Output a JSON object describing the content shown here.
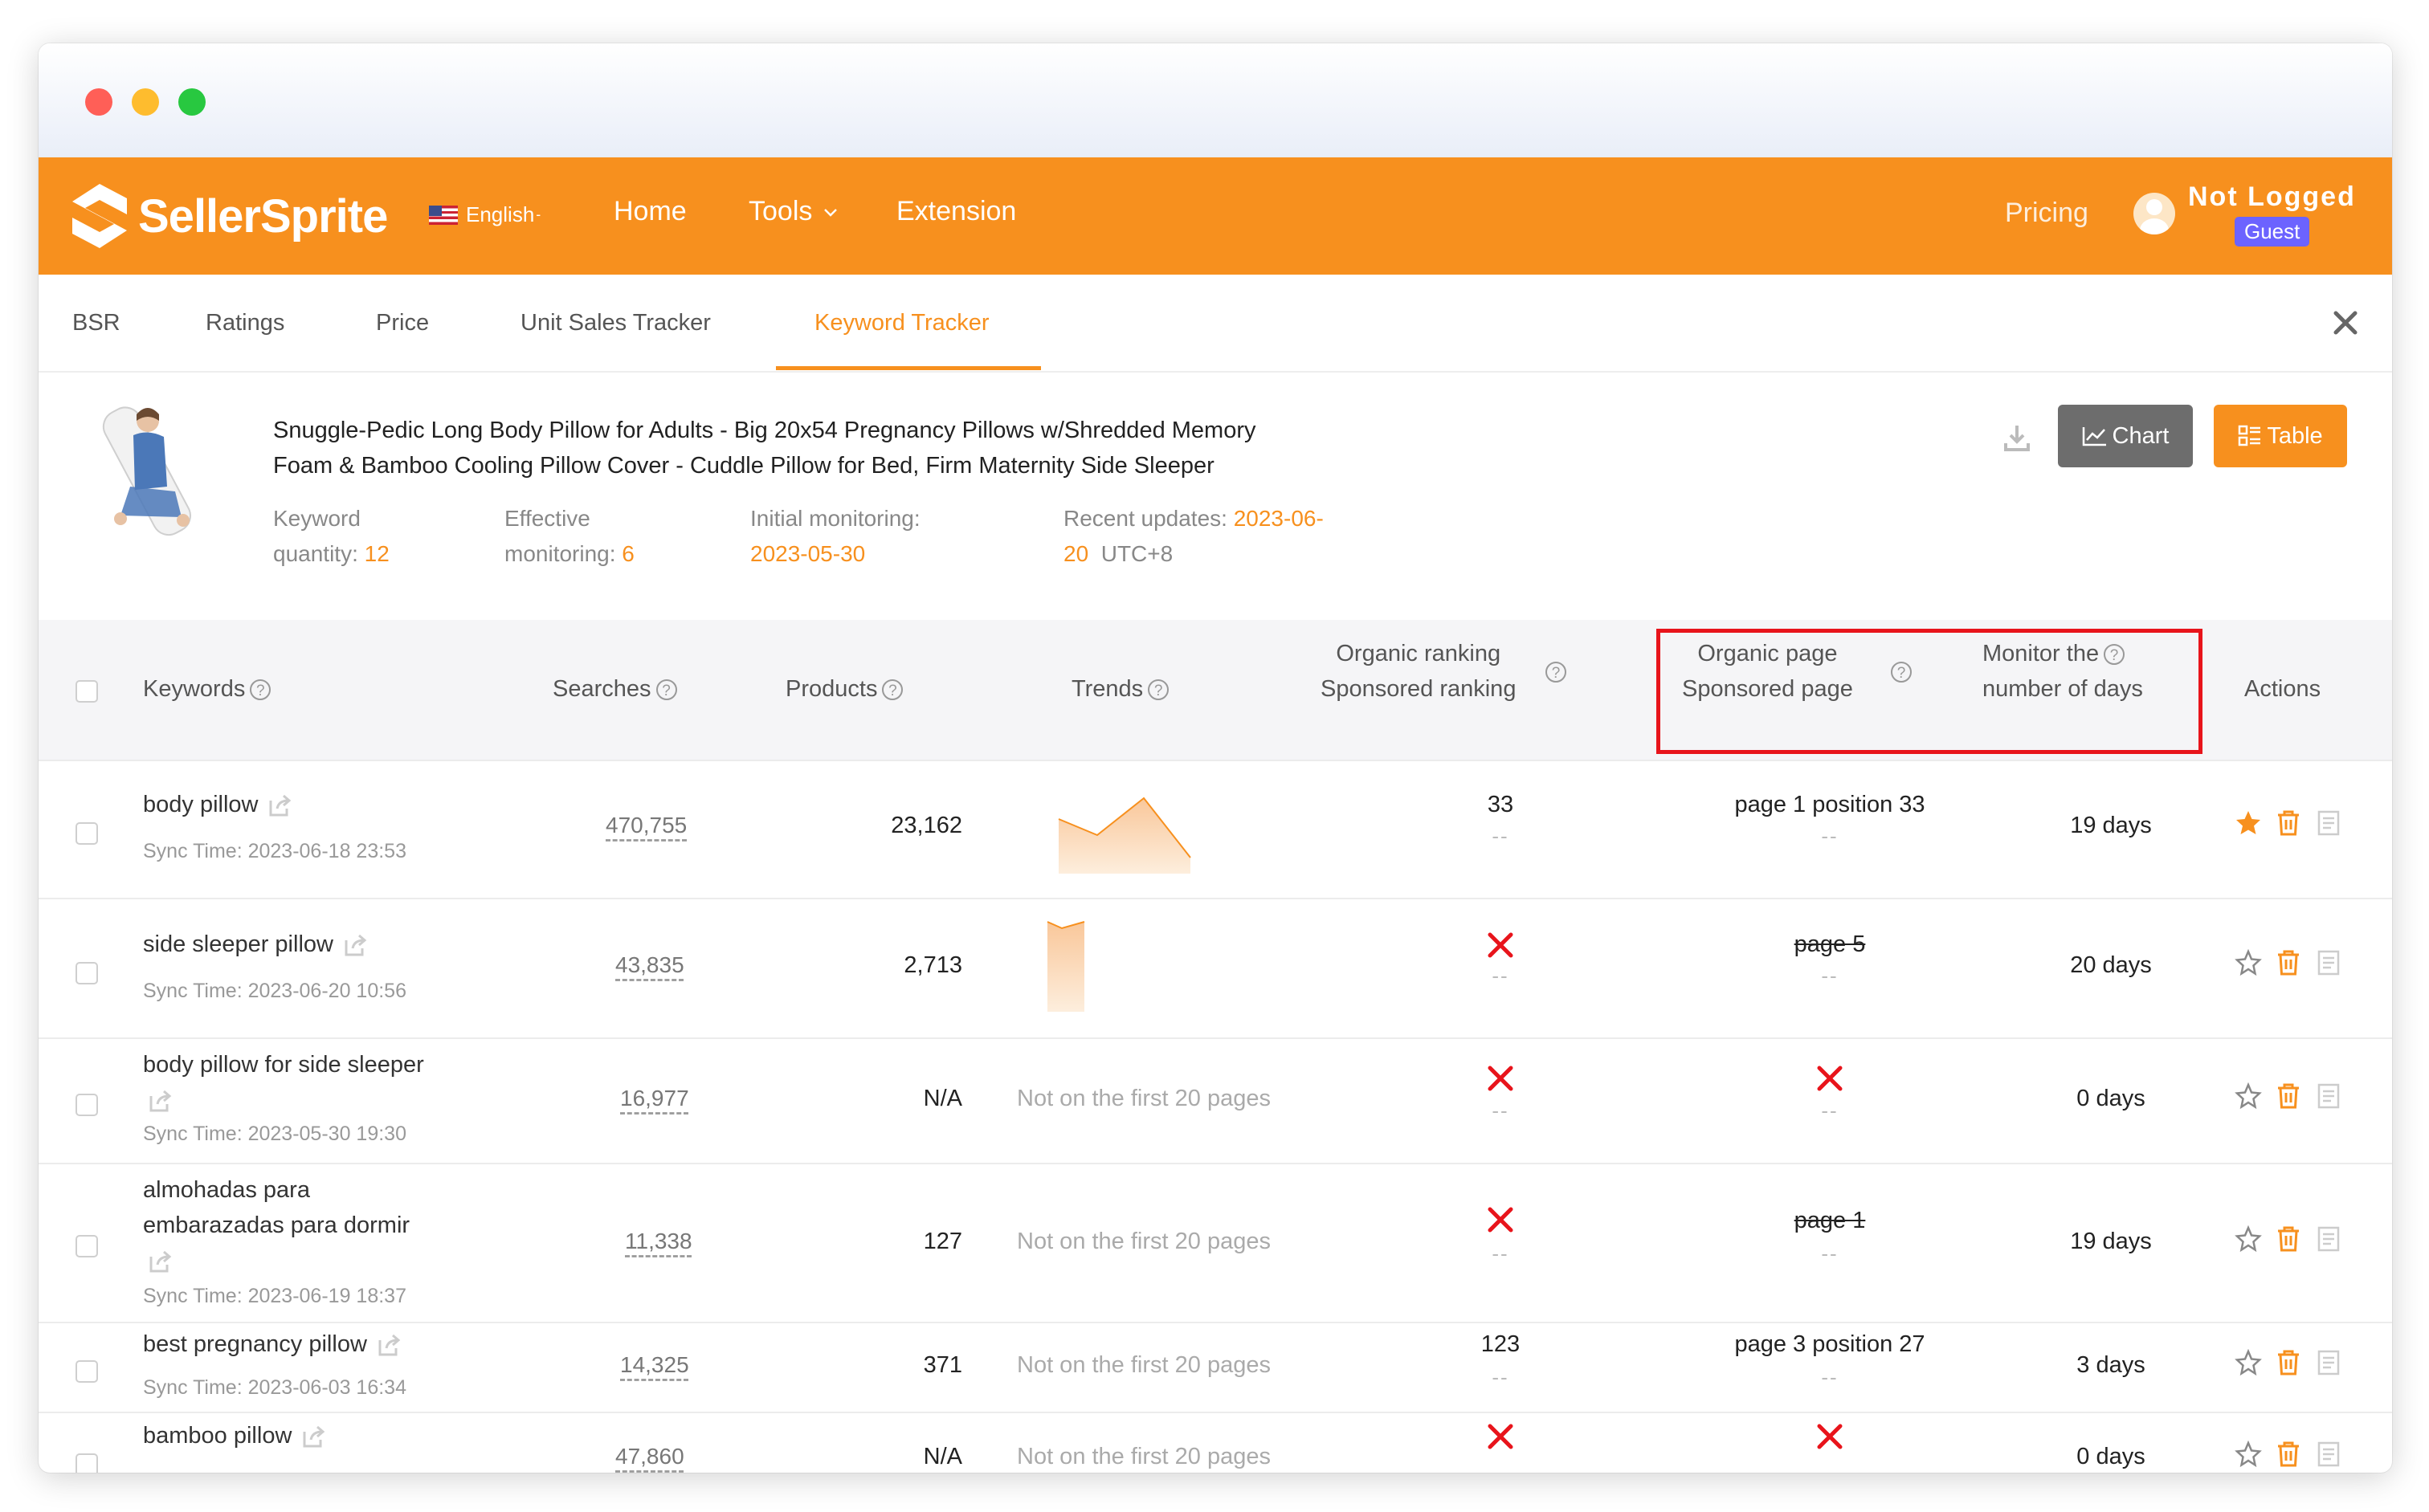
{
  "brand": {
    "name": "SellerSprite",
    "accent": "#f7901e"
  },
  "nav": {
    "language": "English",
    "links": [
      "Home",
      "Tools",
      "Extension"
    ],
    "pricing": "Pricing",
    "user": "Not Logged",
    "badge": "Guest"
  },
  "tabs": [
    "BSR",
    "Ratings",
    "Price",
    "Unit Sales Tracker",
    "Keyword Tracker"
  ],
  "active_tab": "Keyword Tracker",
  "product": {
    "title_line1": "Snuggle-Pedic Long Body Pillow for Adults - Big 20x54 Pregnancy Pillows w/Shredded Memory",
    "title_line2": "Foam & Bamboo Cooling Pillow Cover - Cuddle Pillow for Bed, Firm Maternity Side Sleeper",
    "kw_label1": "Keyword",
    "kw_label2": "quantity:",
    "kw_value": "12",
    "eff_label1": "Effective",
    "eff_label2": "monitoring:",
    "eff_value": "6",
    "init_label": "Initial monitoring:",
    "init_value": "2023-05-30",
    "recent_label": "Recent updates:",
    "recent_value1": "2023-06-",
    "recent_value2": "20",
    "tz": "UTC+8"
  },
  "buttons": {
    "chart": "Chart",
    "table": "Table"
  },
  "columns": {
    "keywords": "Keywords",
    "searches": "Searches",
    "products": "Products",
    "trends": "Trends",
    "organic_ranking": "Organic ranking",
    "sponsored_ranking": "Sponsored ranking",
    "organic_page": "Organic page",
    "sponsored_page": "Sponsored page",
    "monitor1": "Monitor the",
    "monitor2": "number of days",
    "actions": "Actions"
  },
  "rows": [
    {
      "keyword": "body pillow",
      "keyword2": "",
      "sync": "Sync Time: 2023-06-18 23:53",
      "searches": "470,755",
      "products": "23,162",
      "trend": "",
      "organic_rank": "33",
      "organic_rank_x": false,
      "organic_page": "page 1 position 33",
      "organic_page_strike": false,
      "organic_page_x": false,
      "days": "19 days",
      "starred": true
    },
    {
      "keyword": "side sleeper pillow",
      "keyword2": "",
      "sync": "Sync Time: 2023-06-20 10:56",
      "searches": "43,835",
      "products": "2,713",
      "trend": "",
      "organic_rank": "",
      "organic_rank_x": true,
      "organic_page": "page 5",
      "organic_page_strike": true,
      "organic_page_x": false,
      "days": "20 days",
      "starred": false
    },
    {
      "keyword": "body pillow for side sleeper",
      "keyword2": "",
      "sync": "Sync Time: 2023-05-30 19:30",
      "searches": "16,977",
      "products": "N/A",
      "trend": "Not on the first 20 pages",
      "organic_rank": "",
      "organic_rank_x": true,
      "organic_page": "",
      "organic_page_strike": false,
      "organic_page_x": true,
      "days": "0 days",
      "starred": false
    },
    {
      "keyword": "almohadas para",
      "keyword2": "embarazadas para dormir",
      "sync": "Sync Time: 2023-06-19 18:37",
      "searches": "11,338",
      "products": "127",
      "trend": "Not on the first 20 pages",
      "organic_rank": "",
      "organic_rank_x": true,
      "organic_page": "page 1",
      "organic_page_strike": true,
      "organic_page_x": false,
      "days": "19 days",
      "starred": false
    },
    {
      "keyword": "best pregnancy pillow",
      "keyword2": "",
      "sync": "Sync Time: 2023-06-03 16:34",
      "searches": "14,325",
      "products": "371",
      "trend": "Not on the first 20 pages",
      "organic_rank": "123",
      "organic_rank_x": false,
      "organic_page": "page 3 position 27",
      "organic_page_strike": false,
      "organic_page_x": false,
      "days": "3 days",
      "starred": false
    },
    {
      "keyword": "bamboo pillow",
      "keyword2": "",
      "sync": "",
      "searches": "47,860",
      "products": "N/A",
      "trend": "Not on the first 20 pages",
      "organic_rank": "",
      "organic_rank_x": true,
      "organic_page": "",
      "organic_page_strike": false,
      "organic_page_x": true,
      "days": "0 days",
      "starred": false
    }
  ],
  "dash": "--"
}
